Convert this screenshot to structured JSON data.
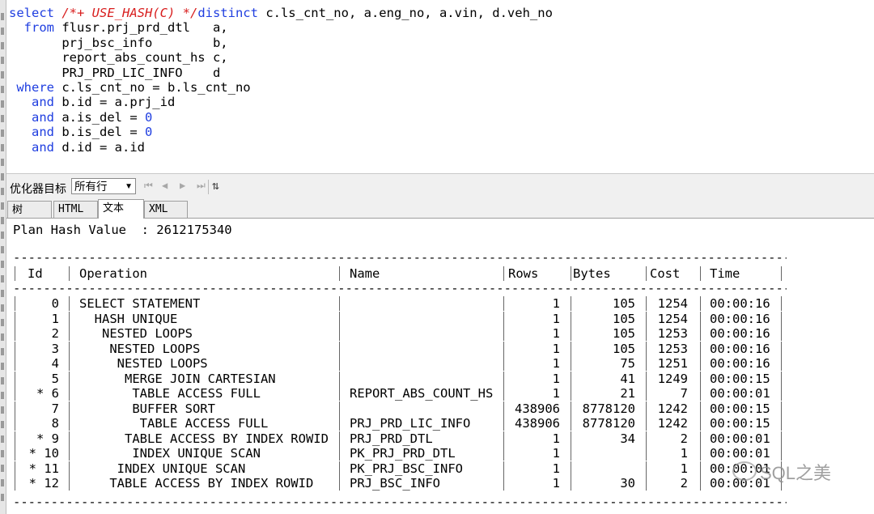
{
  "editor": {
    "lines": [
      {
        "parts": [
          [
            "kw",
            "select "
          ],
          [
            "cm",
            "/*+ USE_HASH(C) */"
          ],
          [
            "kw",
            "distinct "
          ],
          [
            "",
            "c.ls_cnt_no, a.eng_no, a.vin, d.veh_no"
          ]
        ]
      },
      {
        "parts": [
          [
            "",
            "  "
          ],
          [
            "kw",
            "from "
          ],
          [
            "",
            "flusr.prj_prd_dtl   a,"
          ]
        ]
      },
      {
        "parts": [
          [
            "",
            "       prj_bsc_info        b,"
          ]
        ]
      },
      {
        "parts": [
          [
            "",
            "       report_abs_count_hs c,"
          ]
        ]
      },
      {
        "parts": [
          [
            "",
            "       PRJ_PRD_LIC_INFO    d"
          ]
        ]
      },
      {
        "parts": [
          [
            "kw",
            " where "
          ],
          [
            "",
            "c.ls_cnt_no = b.ls_cnt_no"
          ]
        ]
      },
      {
        "parts": [
          [
            "",
            "   "
          ],
          [
            "kw",
            "and "
          ],
          [
            "",
            "b.id = a.prj_id"
          ]
        ]
      },
      {
        "parts": [
          [
            "",
            "   "
          ],
          [
            "kw",
            "and "
          ],
          [
            "",
            "a.is_del = "
          ],
          [
            "num",
            "0"
          ]
        ]
      },
      {
        "parts": [
          [
            "",
            "   "
          ],
          [
            "kw",
            "and "
          ],
          [
            "",
            "b.is_del = "
          ],
          [
            "num",
            "0"
          ]
        ]
      },
      {
        "parts": [
          [
            "",
            "   "
          ],
          [
            "kw",
            "and "
          ],
          [
            "",
            "d.id = a.id"
          ]
        ]
      }
    ]
  },
  "toolbar": {
    "optimizer_label": "优化器目标",
    "optimizer_value": "所有行",
    "nav_first": "⏮",
    "nav_prev": "◀",
    "nav_next": "▶",
    "nav_last": "⏭",
    "extra_icon": "⇅"
  },
  "tabs": [
    {
      "label": "树",
      "active": false
    },
    {
      "label": "HTML",
      "active": false
    },
    {
      "label": "文本",
      "active": true
    },
    {
      "label": "XML",
      "active": false
    }
  ],
  "plan": {
    "hash_line": "Plan Hash Value  : 2612175340",
    "dash_line": "------------------------------------------------------------------------------------------------------------------",
    "headers": {
      "id": "Id",
      "operation": "Operation",
      "name": "Name",
      "rows": "Rows",
      "bytes": "Bytes",
      "cost": "Cost",
      "time": "Time"
    },
    "rows": [
      {
        "id": "0",
        "op": "SELECT STATEMENT",
        "name": "",
        "rows": "1",
        "bytes": "105",
        "cost": "1254",
        "time": "00:00:16"
      },
      {
        "id": "1",
        "op": "  HASH UNIQUE",
        "name": "",
        "rows": "1",
        "bytes": "105",
        "cost": "1254",
        "time": "00:00:16"
      },
      {
        "id": "2",
        "op": "   NESTED LOOPS",
        "name": "",
        "rows": "1",
        "bytes": "105",
        "cost": "1253",
        "time": "00:00:16"
      },
      {
        "id": "3",
        "op": "    NESTED LOOPS",
        "name": "",
        "rows": "1",
        "bytes": "105",
        "cost": "1253",
        "time": "00:00:16"
      },
      {
        "id": "4",
        "op": "     NESTED LOOPS",
        "name": "",
        "rows": "1",
        "bytes": "75",
        "cost": "1251",
        "time": "00:00:16"
      },
      {
        "id": "5",
        "op": "      MERGE JOIN CARTESIAN",
        "name": "",
        "rows": "1",
        "bytes": "41",
        "cost": "1249",
        "time": "00:00:15"
      },
      {
        "id": "* 6",
        "op": "       TABLE ACCESS FULL",
        "name": "REPORT_ABS_COUNT_HS",
        "rows": "1",
        "bytes": "21",
        "cost": "7",
        "time": "00:00:01"
      },
      {
        "id": "7",
        "op": "       BUFFER SORT",
        "name": "",
        "rows": "438906",
        "bytes": "8778120",
        "cost": "1242",
        "time": "00:00:15"
      },
      {
        "id": "8",
        "op": "        TABLE ACCESS FULL",
        "name": "PRJ_PRD_LIC_INFO",
        "rows": "438906",
        "bytes": "8778120",
        "cost": "1242",
        "time": "00:00:15"
      },
      {
        "id": "* 9",
        "op": "      TABLE ACCESS BY INDEX ROWID",
        "name": "PRJ_PRD_DTL",
        "rows": "1",
        "bytes": "34",
        "cost": "2",
        "time": "00:00:01"
      },
      {
        "id": "* 10",
        "op": "       INDEX UNIQUE SCAN",
        "name": "PK_PRJ_PRD_DTL",
        "rows": "1",
        "bytes": "",
        "cost": "1",
        "time": "00:00:01"
      },
      {
        "id": "* 11",
        "op": "     INDEX UNIQUE SCAN",
        "name": "PK_PRJ_BSC_INFO",
        "rows": "1",
        "bytes": "",
        "cost": "1",
        "time": "00:00:01"
      },
      {
        "id": "* 12",
        "op": "    TABLE ACCESS BY INDEX ROWID",
        "name": "PRJ_BSC_INFO",
        "rows": "1",
        "bytes": "30",
        "cost": "2",
        "time": "00:00:01"
      }
    ]
  },
  "watermark": "SQL之美"
}
